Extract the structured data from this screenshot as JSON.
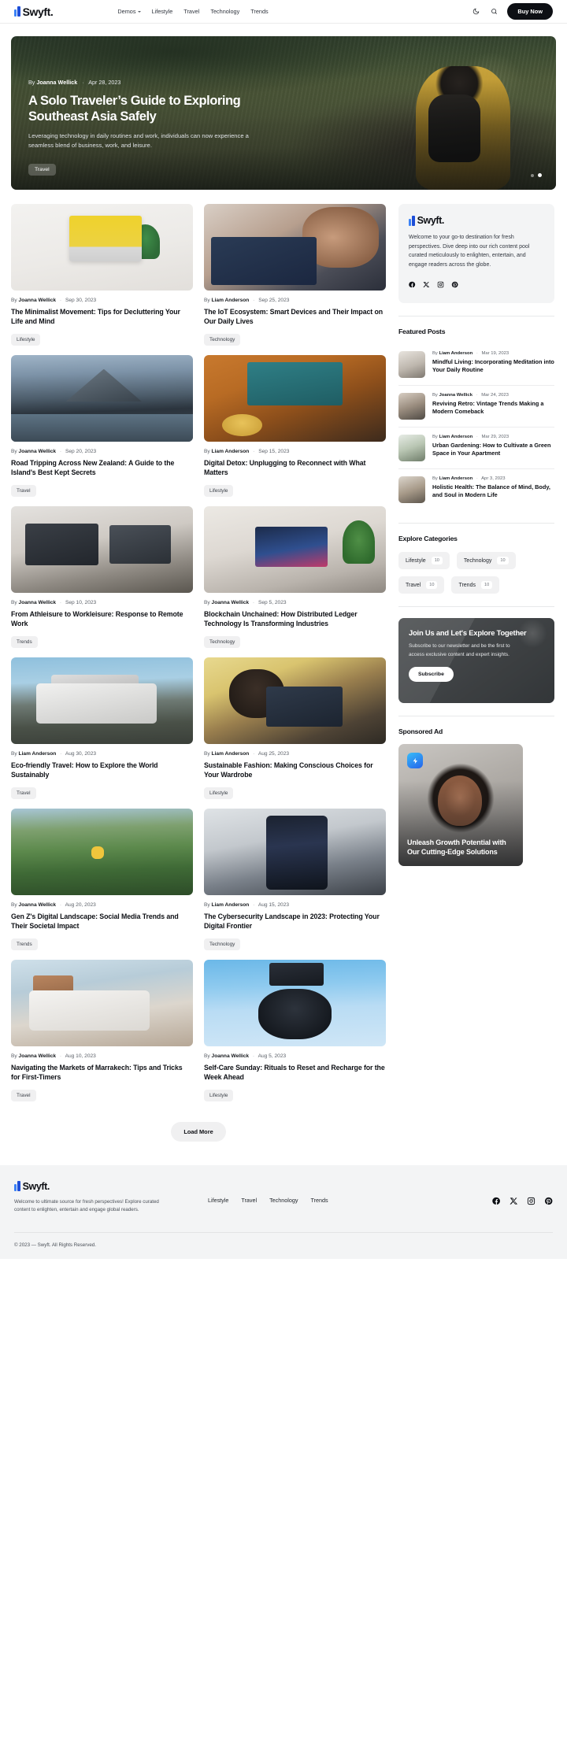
{
  "header": {
    "brand": "Swyft.",
    "nav": [
      {
        "label": "Demos",
        "has_dropdown": true
      },
      {
        "label": "Lifestyle",
        "has_dropdown": false
      },
      {
        "label": "Travel",
        "has_dropdown": false
      },
      {
        "label": "Technology",
        "has_dropdown": false
      },
      {
        "label": "Trends",
        "has_dropdown": false
      }
    ],
    "theme_icon": "moon-icon",
    "search_icon": "search-icon",
    "cta": "Buy Now"
  },
  "hero": {
    "author_prefix": "By",
    "author": "Joanna Wellick",
    "date": "Apr 28, 2023",
    "title": "A Solo Traveler’s Guide to Exploring Southeast Asia Safely",
    "description": "Leveraging technology in daily routines and work, individuals can now experience a seamless blend of business, work, and leisure.",
    "tag": "Travel",
    "slide_count": 2,
    "active_slide": 2
  },
  "articles": [
    {
      "author_prefix": "By",
      "author": "Joanna Wellick",
      "date": "Sep 30, 2023",
      "title": "The Minimalist Movement: Tips for Decluttering Your Life and Mind",
      "tag": "Lifestyle"
    },
    {
      "author_prefix": "By",
      "author": "Liam Anderson",
      "date": "Sep 25, 2023",
      "title": "The IoT Ecosystem: Smart Devices and Their Impact on Our Daily Lives",
      "tag": "Technology"
    },
    {
      "author_prefix": "By",
      "author": "Joanna Wellick",
      "date": "Sep 20, 2023",
      "title": "Road Tripping Across New Zealand: A Guide to the Island's Best Kept Secrets",
      "tag": "Travel"
    },
    {
      "author_prefix": "By",
      "author": "Liam Anderson",
      "date": "Sep 15, 2023",
      "title": "Digital Detox: Unplugging to Reconnect with What Matters",
      "tag": "Lifestyle"
    },
    {
      "author_prefix": "By",
      "author": "Joanna Wellick",
      "date": "Sep 10, 2023",
      "title": "From Athleisure to Workleisure: Response to Remote Work",
      "tag": "Trends"
    },
    {
      "author_prefix": "By",
      "author": "Joanna Wellick",
      "date": "Sep 5, 2023",
      "title": "Blockchain Unchained: How Distributed Ledger Technology Is Transforming Industries",
      "tag": "Technology"
    },
    {
      "author_prefix": "By",
      "author": "Liam Anderson",
      "date": "Aug 30, 2023",
      "title": "Eco-friendly Travel: How to Explore the World Sustainably",
      "tag": "Travel"
    },
    {
      "author_prefix": "By",
      "author": "Liam Anderson",
      "date": "Aug 25, 2023",
      "title": "Sustainable Fashion: Making Conscious Choices for Your Wardrobe",
      "tag": "Lifestyle"
    },
    {
      "author_prefix": "By",
      "author": "Joanna Wellick",
      "date": "Aug 20, 2023",
      "title": "Gen Z's Digital Landscape: Social Media Trends and Their Societal Impact",
      "tag": "Trends"
    },
    {
      "author_prefix": "By",
      "author": "Liam Anderson",
      "date": "Aug 15, 2023",
      "title": "The Cybersecurity Landscape in 2023: Protecting Your Digital Frontier",
      "tag": "Technology"
    },
    {
      "author_prefix": "By",
      "author": "Joanna Wellick",
      "date": "Aug 10, 2023",
      "title": "Navigating the Markets of Marrakech: Tips and Tricks for First-Timers",
      "tag": "Travel"
    },
    {
      "author_prefix": "By",
      "author": "Joanna Wellick",
      "date": "Aug 5, 2023",
      "title": "Self-Care Sunday: Rituals to Reset and Recharge for the Week Ahead",
      "tag": "Lifestyle"
    }
  ],
  "load_more": "Load More",
  "sidebar": {
    "about": {
      "brand": "Swyft.",
      "text": "Welcome to your go-to destination for fresh perspectives. Dive deep into our rich content pool curated meticulously to enlighten, entertain, and engage readers across the globe.",
      "socials": [
        "facebook-icon",
        "x-icon",
        "instagram-icon",
        "pinterest-icon"
      ]
    },
    "featured": {
      "heading": "Featured Posts",
      "items": [
        {
          "author_prefix": "By",
          "author": "Liam Anderson",
          "date": "Mar 19, 2023",
          "title": "Mindful Living: Incorporating Meditation into Your Daily Routine"
        },
        {
          "author_prefix": "By",
          "author": "Joanna Wellick",
          "date": "Mar 24, 2023",
          "title": "Reviving Retro: Vintage Trends Making a Modern Comeback"
        },
        {
          "author_prefix": "By",
          "author": "Liam Anderson",
          "date": "Mar 29, 2023",
          "title": "Urban Gardening: How to Cultivate a Green Space in Your Apartment"
        },
        {
          "author_prefix": "By",
          "author": "Liam Anderson",
          "date": "Apr 3, 2023",
          "title": "Holistic Health: The Balance of Mind, Body, and Soul in Modern Life"
        }
      ]
    },
    "categories": {
      "heading": "Explore Categories",
      "items": [
        {
          "name": "Lifestyle",
          "count": "10"
        },
        {
          "name": "Technology",
          "count": "10"
        },
        {
          "name": "Travel",
          "count": "10"
        },
        {
          "name": "Trends",
          "count": "10"
        }
      ]
    },
    "promo": {
      "title": "Join Us and Let's Explore Together",
      "description": "Subscribe to our newsletter and be the first to access exclusive content and expert insights.",
      "button": "Subscribe"
    },
    "ad": {
      "heading": "Sponsored Ad",
      "badge_icon": "lightning-bolt-icon",
      "title": "Unleash Growth Potential with Our Cutting-Edge Solutions"
    }
  },
  "footer": {
    "brand": "Swyft.",
    "description": "Welcome to ultimate source for fresh perspectives! Explore curated content to enlighten, entertain and engage global readers.",
    "nav": [
      "Lifestyle",
      "Travel",
      "Technology",
      "Trends"
    ],
    "socials": [
      "facebook-icon",
      "x-icon",
      "instagram-icon",
      "pinterest-icon"
    ],
    "copyright": "© 2023 — Swyft. All Rights Reserved."
  },
  "colors": {
    "accent": "#2563eb",
    "ink": "#0d0f14",
    "muted": "#5b6068",
    "surface": "#f3f4f5",
    "chip": "#f0f0f1"
  }
}
